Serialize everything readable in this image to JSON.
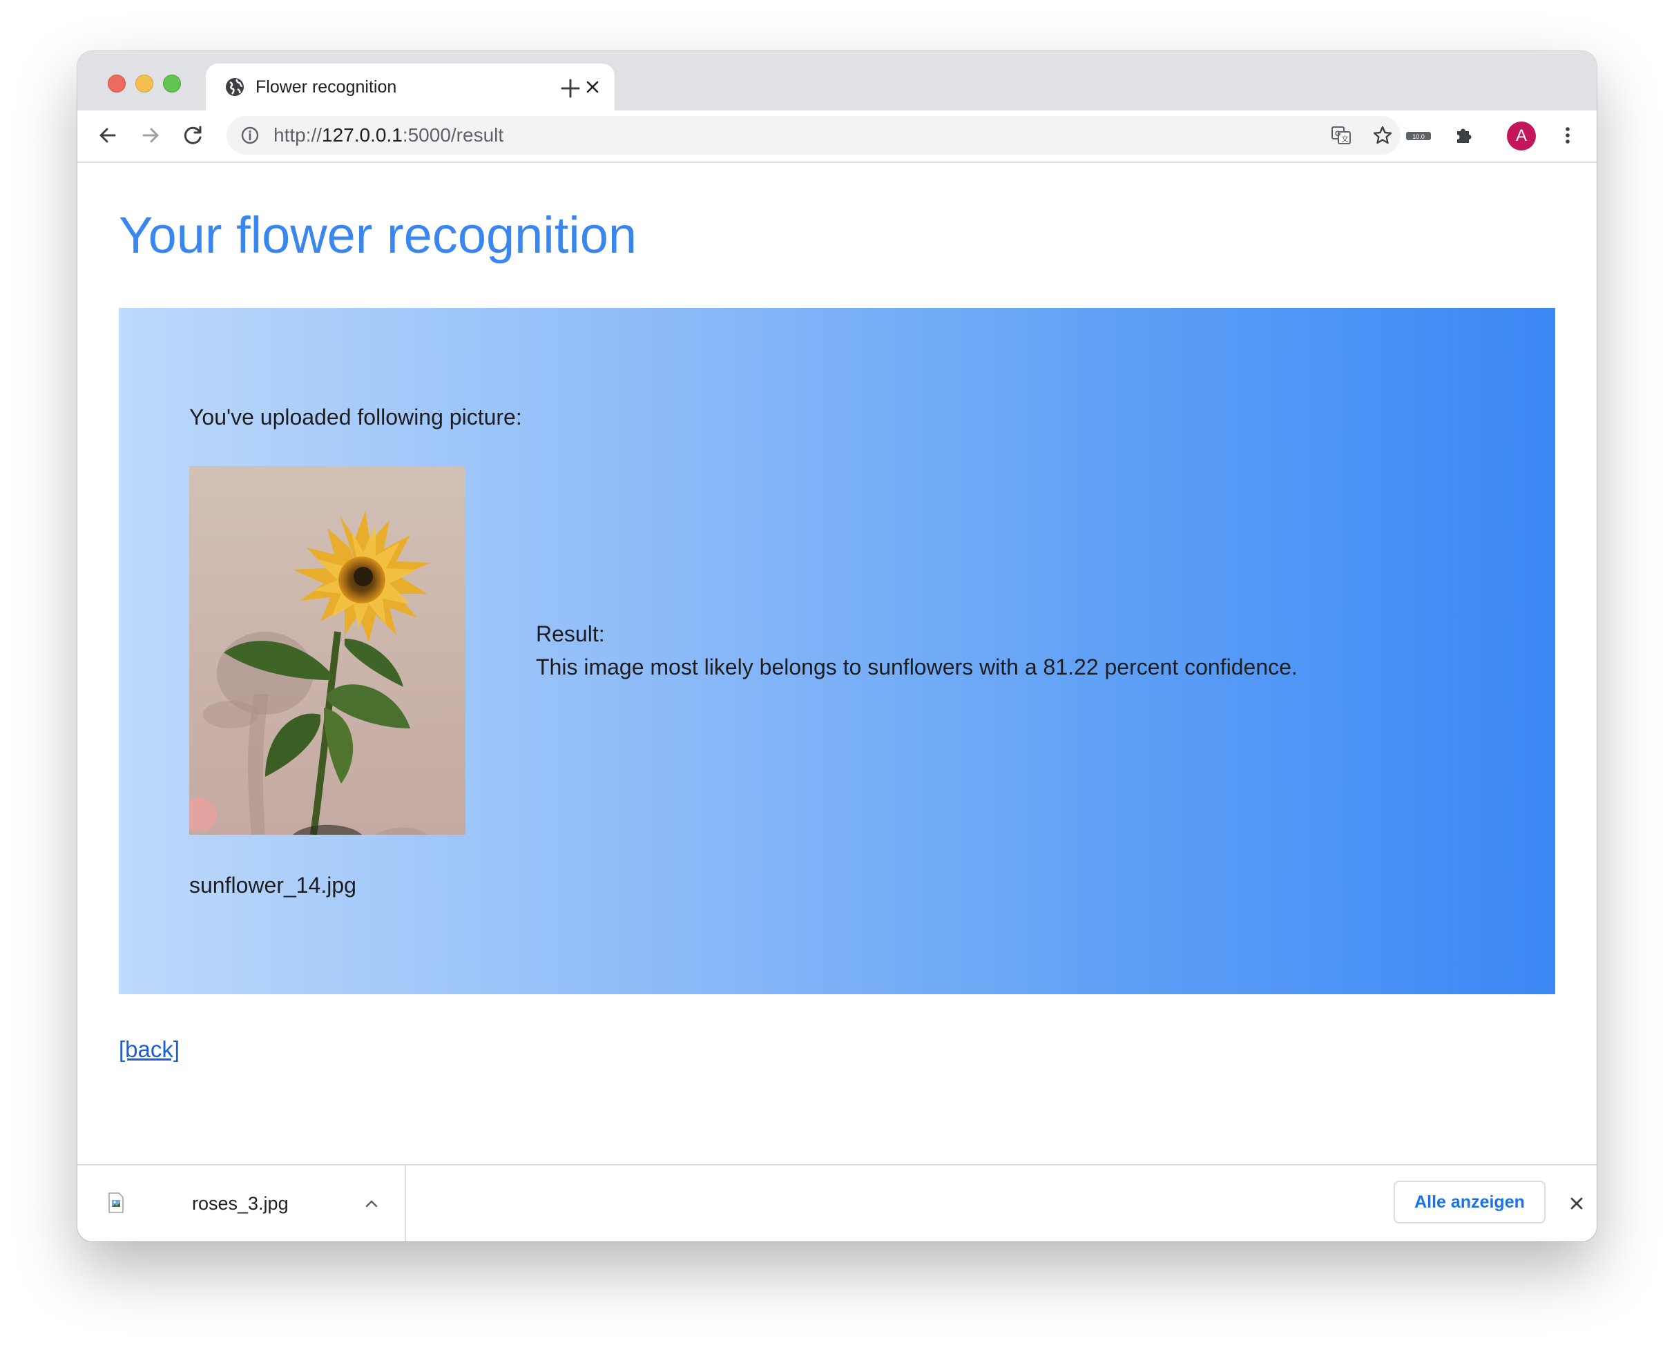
{
  "browser": {
    "tab": {
      "title": "Flower recognition",
      "favicon": "globe-icon"
    },
    "address_bar": {
      "scheme": "http://",
      "host": "127.0.0.1",
      "path": ":5000/result"
    },
    "profile_initial": "A",
    "profile_color": "#c2185b",
    "toolbar_icons": [
      "back-icon",
      "forward-icon",
      "reload-icon",
      "info-icon",
      "translate-icon",
      "bookmark-star-icon",
      "extension-badge-icon",
      "puzzle-icon",
      "avatar",
      "more-vert-icon"
    ]
  },
  "page": {
    "title": "Your flower recognition",
    "title_color": "#3a86f0",
    "uploaded_label": "You've uploaded following picture:",
    "image_subject": "sunflower photo",
    "filename": "sunflower_14.jpg",
    "result_label": "Result:",
    "result_text": "This image most likely belongs to sunflowers with a 81.22 percent confidence.",
    "back_link": "[back]",
    "gradient": [
      "#bdd9fb",
      "#3b87f5"
    ]
  },
  "download_shelf": {
    "file_name": "roses_3.jpg",
    "show_all_label": "Alle anzeigen"
  }
}
